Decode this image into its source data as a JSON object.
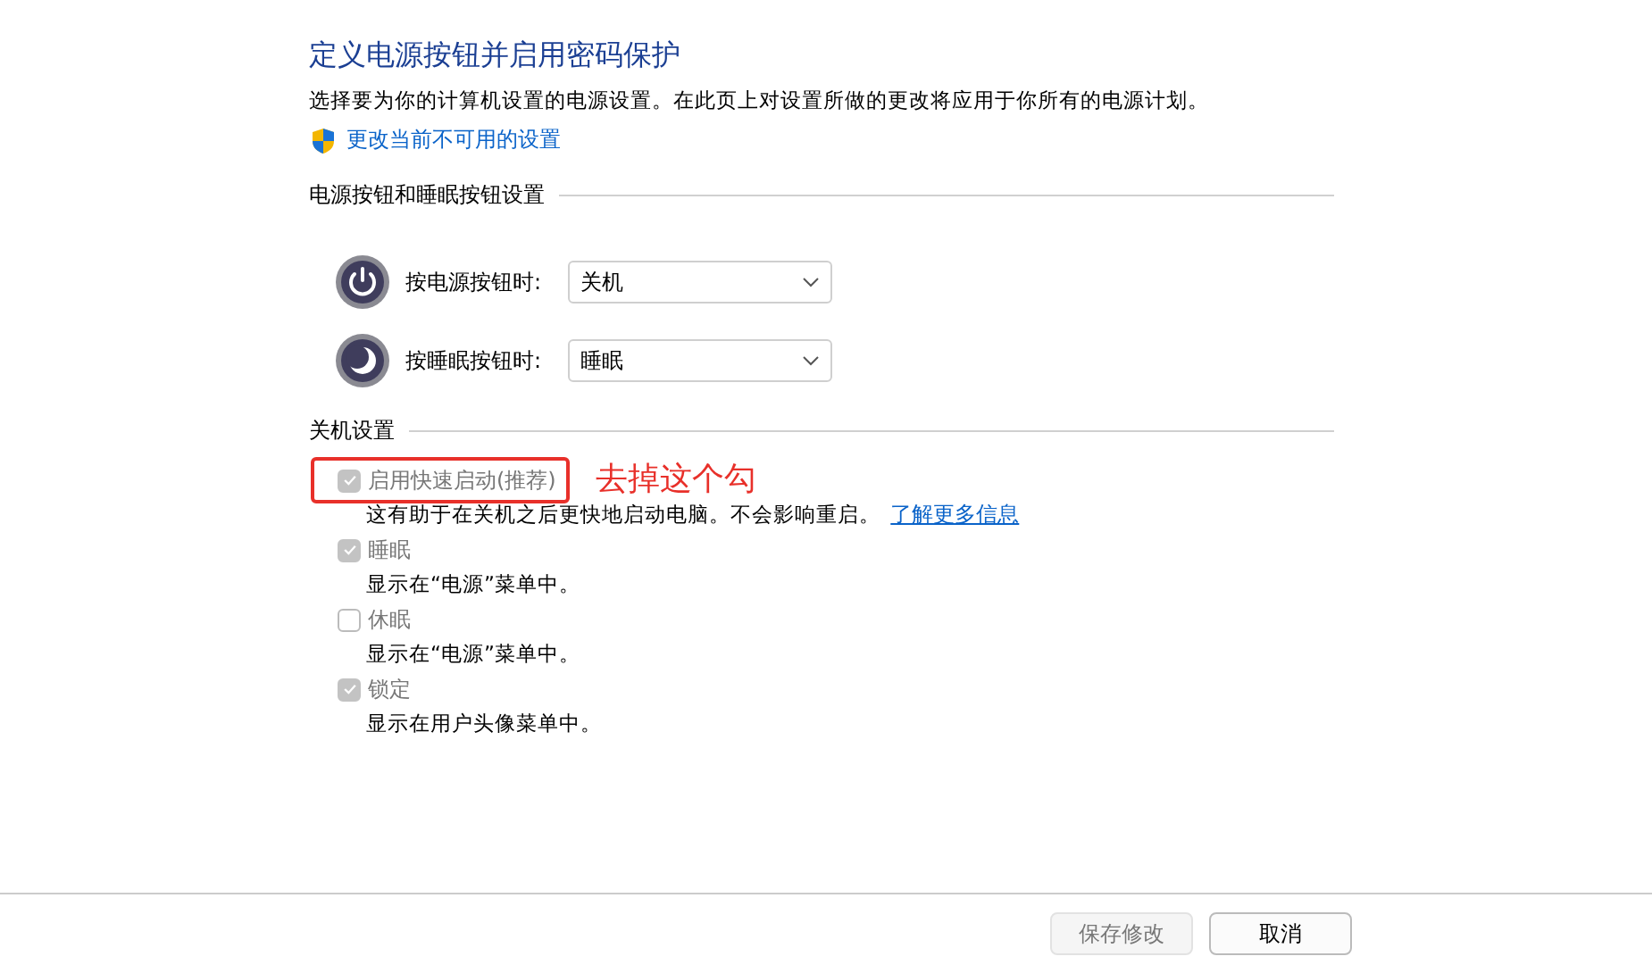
{
  "title": "定义电源按钮并启用密码保护",
  "description": "选择要为你的计算机设置的电源设置。在此页上对设置所做的更改将应用于你所有的电源计划。",
  "admin_link": "更改当前不可用的设置",
  "buttons_section": {
    "heading": "电源按钮和睡眠按钮设置",
    "rows": [
      {
        "kind": "power",
        "label": "按电源按钮时:",
        "value": "关机"
      },
      {
        "kind": "sleep",
        "label": "按睡眠按钮时:",
        "value": "睡眠"
      }
    ]
  },
  "shutdown_section": {
    "heading": "关机设置",
    "options": [
      {
        "label": "启用快速启动(推荐)",
        "checked": true,
        "disabled": true,
        "description": "这有助于在关机之后更快地启动电脑。不会影响重启。",
        "link": "了解更多信息"
      },
      {
        "label": "睡眠",
        "checked": true,
        "disabled": true,
        "description": "显示在“电源”菜单中。"
      },
      {
        "label": "休眠",
        "checked": false,
        "disabled": true,
        "description": "显示在“电源”菜单中。"
      },
      {
        "label": "锁定",
        "checked": true,
        "disabled": true,
        "description": "显示在用户头像菜单中。"
      }
    ]
  },
  "annotation": {
    "text": "去掉这个勾"
  },
  "footer_buttons": [
    {
      "label": "保存修改",
      "disabled": true
    },
    {
      "label": "取消",
      "disabled": false
    }
  ]
}
